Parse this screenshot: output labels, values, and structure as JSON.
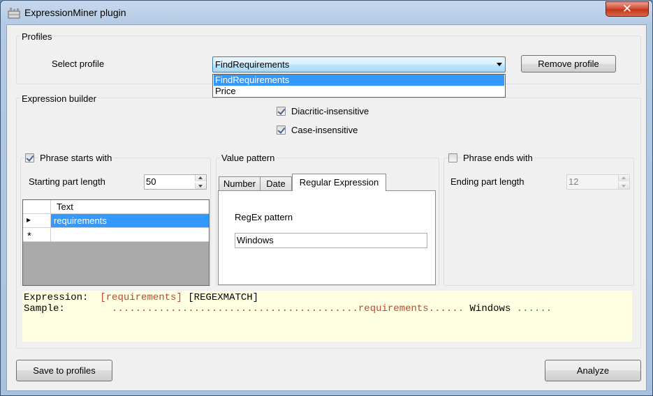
{
  "window": {
    "title": "ExpressionMiner plugin",
    "close_glyph": "✕",
    "app_icon": "app-icon"
  },
  "profiles": {
    "group_label": "Profiles",
    "select_label": "Select profile",
    "selected": "FindRequirements",
    "options": [
      "FindRequirements",
      "Price"
    ],
    "remove_button": "Remove profile"
  },
  "builder": {
    "group_label": "Expression builder",
    "diacritic_label": "Diacritic-insensitive",
    "diacritic_checked": true,
    "case_label": "Case-insensitive",
    "case_checked": true
  },
  "phrase_starts": {
    "label": "Phrase starts with",
    "checked": true,
    "length_label": "Starting part length",
    "length_value": "50",
    "grid": {
      "column_header": "Text",
      "rows": [
        "requirements"
      ],
      "current_row_marker": "▸",
      "new_row_marker": "*"
    }
  },
  "value_pattern": {
    "label": "Value pattern",
    "tabs": [
      "Number",
      "Date",
      "Regular Expression"
    ],
    "active_tab": "Regular Expression",
    "regex_label": "RegEx pattern",
    "regex_value": "Windows"
  },
  "phrase_ends": {
    "label": "Phrase ends with",
    "checked": false,
    "length_label": "Ending part length",
    "length_value": "12"
  },
  "expression": {
    "expr_label": "Expression:",
    "expr_start": "[requirements]",
    "expr_value": "[REGEXMATCH]",
    "sample_label": "Sample:",
    "sample_start": "..........................................requirements......",
    "sample_value": "Windows",
    "sample_end": "......"
  },
  "footer": {
    "save_button": "Save to profiles",
    "analyze_button": "Analyze"
  },
  "colors": {
    "selection": "#3399ff",
    "expr_background": "#ffffe1",
    "expr_red": "#b84a2f",
    "expr_green": "#2b9b2b"
  }
}
